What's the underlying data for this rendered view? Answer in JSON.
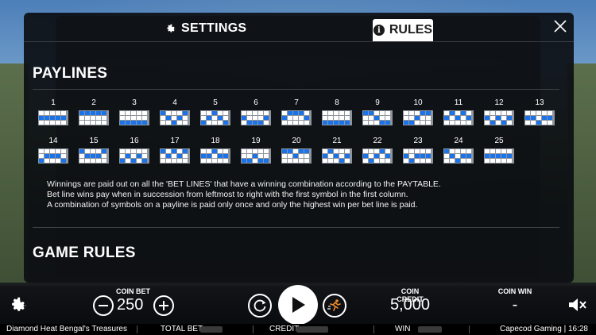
{
  "modal": {
    "tabs": {
      "settings_label": "SETTINGS",
      "rules_label": "RULES",
      "active": "RULES"
    },
    "paylines_title": "PAYLINES",
    "game_rules_title": "GAME RULES",
    "paylines": [
      {
        "number": "1",
        "pattern": [
          [
            0,
            0,
            0,
            0,
            0
          ],
          [
            1,
            1,
            1,
            1,
            1
          ],
          [
            0,
            0,
            0,
            0,
            0
          ]
        ]
      },
      {
        "number": "2",
        "pattern": [
          [
            1,
            1,
            1,
            1,
            1
          ],
          [
            0,
            0,
            0,
            0,
            0
          ],
          [
            0,
            0,
            0,
            0,
            0
          ]
        ]
      },
      {
        "number": "3",
        "pattern": [
          [
            0,
            0,
            0,
            0,
            0
          ],
          [
            0,
            0,
            0,
            0,
            0
          ],
          [
            1,
            1,
            1,
            1,
            1
          ]
        ]
      },
      {
        "number": "4",
        "pattern": [
          [
            1,
            0,
            0,
            0,
            1
          ],
          [
            0,
            1,
            0,
            1,
            0
          ],
          [
            0,
            0,
            1,
            0,
            0
          ]
        ]
      },
      {
        "number": "5",
        "pattern": [
          [
            0,
            0,
            1,
            0,
            0
          ],
          [
            0,
            1,
            0,
            1,
            0
          ],
          [
            1,
            0,
            0,
            0,
            1
          ]
        ]
      },
      {
        "number": "6",
        "pattern": [
          [
            0,
            0,
            0,
            0,
            0
          ],
          [
            1,
            0,
            0,
            0,
            1
          ],
          [
            0,
            1,
            1,
            1,
            0
          ]
        ]
      },
      {
        "number": "7",
        "pattern": [
          [
            0,
            1,
            1,
            1,
            0
          ],
          [
            1,
            0,
            0,
            0,
            1
          ],
          [
            0,
            0,
            0,
            0,
            0
          ]
        ]
      },
      {
        "number": "8",
        "pattern": [
          [
            0,
            0,
            0,
            0,
            0
          ],
          [
            0,
            0,
            0,
            0,
            0
          ],
          [
            1,
            1,
            1,
            1,
            1
          ]
        ]
      },
      {
        "number": "9",
        "pattern": [
          [
            1,
            1,
            0,
            0,
            0
          ],
          [
            0,
            0,
            1,
            0,
            0
          ],
          [
            0,
            0,
            0,
            1,
            1
          ]
        ]
      },
      {
        "number": "10",
        "pattern": [
          [
            0,
            0,
            0,
            1,
            1
          ],
          [
            0,
            0,
            1,
            0,
            0
          ],
          [
            1,
            1,
            0,
            0,
            0
          ]
        ]
      },
      {
        "number": "11",
        "pattern": [
          [
            0,
            1,
            0,
            1,
            0
          ],
          [
            1,
            0,
            1,
            0,
            1
          ],
          [
            0,
            0,
            0,
            0,
            0
          ]
        ]
      },
      {
        "number": "12",
        "pattern": [
          [
            0,
            0,
            0,
            0,
            0
          ],
          [
            1,
            0,
            1,
            0,
            1
          ],
          [
            0,
            1,
            0,
            1,
            0
          ]
        ]
      },
      {
        "number": "13",
        "pattern": [
          [
            0,
            0,
            0,
            0,
            0
          ],
          [
            1,
            1,
            0,
            1,
            1
          ],
          [
            0,
            0,
            1,
            0,
            0
          ]
        ]
      },
      {
        "number": "14",
        "pattern": [
          [
            0,
            0,
            0,
            0,
            0
          ],
          [
            0,
            1,
            1,
            1,
            0
          ],
          [
            1,
            0,
            0,
            0,
            1
          ]
        ]
      },
      {
        "number": "15",
        "pattern": [
          [
            1,
            0,
            0,
            0,
            1
          ],
          [
            0,
            1,
            1,
            1,
            0
          ],
          [
            0,
            0,
            0,
            0,
            0
          ]
        ]
      },
      {
        "number": "16",
        "pattern": [
          [
            0,
            0,
            0,
            0,
            0
          ],
          [
            0,
            1,
            0,
            1,
            0
          ],
          [
            1,
            0,
            1,
            0,
            1
          ]
        ]
      },
      {
        "number": "17",
        "pattern": [
          [
            1,
            0,
            1,
            0,
            1
          ],
          [
            0,
            1,
            0,
            1,
            0
          ],
          [
            0,
            0,
            0,
            0,
            0
          ]
        ]
      },
      {
        "number": "18",
        "pattern": [
          [
            0,
            0,
            1,
            0,
            0
          ],
          [
            1,
            1,
            0,
            1,
            1
          ],
          [
            0,
            0,
            0,
            0,
            0
          ]
        ]
      },
      {
        "number": "19",
        "pattern": [
          [
            0,
            0,
            0,
            0,
            0
          ],
          [
            0,
            0,
            1,
            0,
            0
          ],
          [
            1,
            1,
            0,
            1,
            1
          ]
        ]
      },
      {
        "number": "20",
        "pattern": [
          [
            1,
            1,
            0,
            1,
            1
          ],
          [
            0,
            0,
            1,
            0,
            0
          ],
          [
            0,
            0,
            0,
            0,
            0
          ]
        ]
      },
      {
        "number": "21",
        "pattern": [
          [
            0,
            1,
            0,
            0,
            0
          ],
          [
            1,
            0,
            1,
            0,
            1
          ],
          [
            0,
            0,
            0,
            1,
            0
          ]
        ]
      },
      {
        "number": "22",
        "pattern": [
          [
            0,
            0,
            0,
            1,
            0
          ],
          [
            1,
            0,
            1,
            0,
            1
          ],
          [
            0,
            1,
            0,
            0,
            0
          ]
        ]
      },
      {
        "number": "23",
        "pattern": [
          [
            0,
            0,
            0,
            0,
            0
          ],
          [
            1,
            0,
            1,
            1,
            1
          ],
          [
            0,
            1,
            0,
            0,
            0
          ]
        ]
      },
      {
        "number": "24",
        "pattern": [
          [
            1,
            0,
            0,
            0,
            0
          ],
          [
            0,
            1,
            0,
            1,
            1
          ],
          [
            0,
            0,
            1,
            0,
            0
          ]
        ]
      },
      {
        "number": "25",
        "pattern": [
          [
            0,
            0,
            0,
            0,
            0
          ],
          [
            1,
            1,
            1,
            1,
            1
          ],
          [
            0,
            0,
            0,
            0,
            0
          ]
        ]
      }
    ],
    "rules_text": [
      "Winnings are paid out on all the 'BET LINES' that have a winning combination according to the PAYTABLE.",
      "Bet line wins pay when in succession from leftmost to right with the first symbol in the first column.",
      "A combination of symbols on a payline is paid only once and only the highest win per bet line is paid."
    ]
  },
  "controls": {
    "coin_bet_label": "COIN BET",
    "coin_bet_value": "250",
    "coin_credit_label": "COIN CREDIT",
    "coin_credit_value": "5,000",
    "coin_win_label": "COIN WIN",
    "coin_win_value": "-"
  },
  "status_bar": {
    "game_name": "Diamond Heat Bengal's Treasures",
    "total_bet_label": "TOTAL BET",
    "credit_label": "CREDIT",
    "win_label": "WIN",
    "provider": "Capecod Gaming | 16:28"
  },
  "colors": {
    "payline_on": "#1a73e8",
    "modal_bg": "#0c0e12",
    "accent_white": "#ffffff"
  },
  "icons": {
    "settings_tab": "gear-icon",
    "rules_tab": "info-icon",
    "close": "close-icon",
    "settings_button": "gear-icon",
    "autoplay": "autoplay-icon",
    "spin": "play-icon",
    "turbo": "turbo-runner-icon",
    "sound": "speaker-muted-icon"
  }
}
